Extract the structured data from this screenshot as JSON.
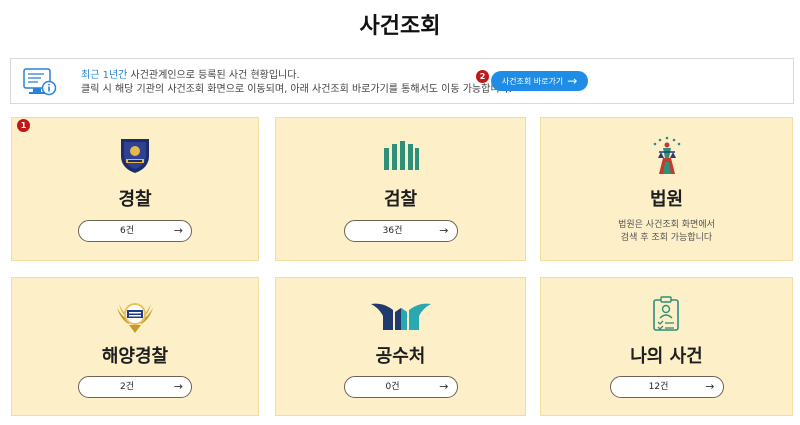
{
  "page": {
    "title": "사건조회"
  },
  "info": {
    "line1_highlight": "최근 1년간",
    "line1_rest": " 사건관계인으로 등록된 사건 현황입니다.",
    "line2": "클릭 시 해당 기관의 사건조회 화면으로 이동되며, 아래 사건조회 바로가기를 통해서도 이동 가능합니다.",
    "shortcut_label": "사건조회 바로가기",
    "shortcut_arrow": "→"
  },
  "badges": {
    "first": "1",
    "second": "2"
  },
  "cards": [
    {
      "name": "경찰",
      "count": "6건",
      "icon": "police-emblem-icon"
    },
    {
      "name": "검찰",
      "count": "36건",
      "icon": "prosecution-emblem-icon"
    },
    {
      "name": "법원",
      "desc_line1": "법원은 사건조회 화면에서",
      "desc_line2": "검색 후 조회 가능합니다",
      "icon": "court-emblem-icon"
    },
    {
      "name": "해양경찰",
      "count": "2건",
      "icon": "coast-guard-emblem-icon"
    },
    {
      "name": "공수처",
      "count": "0건",
      "icon": "cio-emblem-icon"
    },
    {
      "name": "나의 사건",
      "count": "12건",
      "icon": "my-case-icon"
    }
  ],
  "pill_arrow": "→",
  "colors": {
    "card_bg": "#fdefc7",
    "accent": "#1f8ce6",
    "badge": "#c01818",
    "highlight": "#2a82d6"
  }
}
